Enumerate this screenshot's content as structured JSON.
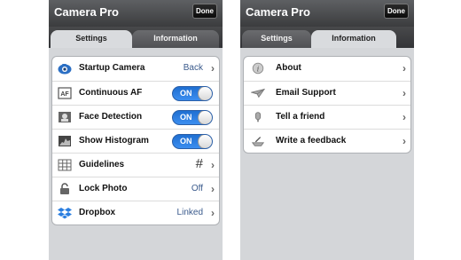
{
  "app": {
    "title": "Camera Pro",
    "done_label": "Done"
  },
  "tabs": {
    "settings": "Settings",
    "information": "Information"
  },
  "settings_rows": [
    {
      "label": "Startup Camera",
      "value": "Back",
      "icon": "camera-icon"
    },
    {
      "label": "Continuous AF",
      "toggle": "ON",
      "icon": "af-icon"
    },
    {
      "label": "Face Detection",
      "toggle": "ON",
      "icon": "face-icon"
    },
    {
      "label": "Show Histogram",
      "toggle": "ON",
      "icon": "histogram-icon"
    },
    {
      "label": "Guidelines",
      "value": "#",
      "icon": "grid-icon"
    },
    {
      "label": "Lock Photo",
      "value": "Off",
      "icon": "lock-icon"
    },
    {
      "label": "Dropbox",
      "value": "Linked",
      "icon": "dropbox-icon"
    }
  ],
  "info_rows": [
    {
      "label": "About",
      "icon": "info-icon"
    },
    {
      "label": "Email Support",
      "icon": "email-icon"
    },
    {
      "label": "Tell a friend",
      "icon": "speaker-icon"
    },
    {
      "label": "Write a feedback",
      "icon": "feedback-icon"
    }
  ],
  "colors": {
    "toggle_on": "#2f7fe0",
    "value_text": "#3a5a8c",
    "topbar": "#46474a"
  }
}
